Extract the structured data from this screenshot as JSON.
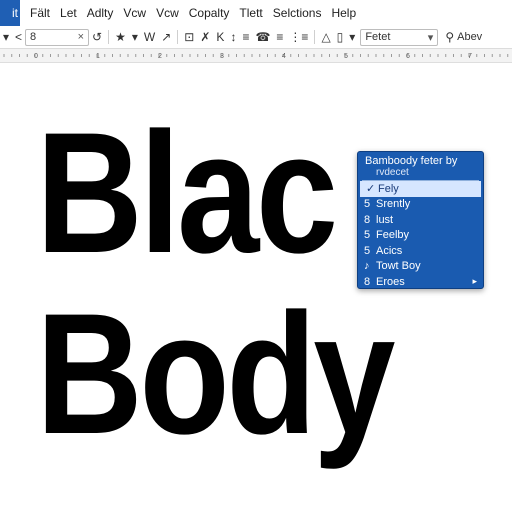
{
  "menubar": {
    "app_menu_label": "it",
    "items": [
      "Fält",
      "Let",
      "Adlty",
      "Vcw",
      "Vcw",
      "Copalty",
      "Tlett",
      "Selctions",
      "Help"
    ]
  },
  "toolbar": {
    "field_value": "8",
    "field_clear": "×",
    "style_field_value": "Fetet",
    "style_field_arrow": "▾",
    "right_label": "Abev",
    "glyphs": {
      "g1": "▾",
      "g2": "<",
      "g3": "↺",
      "g4": "★",
      "g5": "▾",
      "g6": "W",
      "g7": "↗",
      "g8": "⊡",
      "g9": "✗",
      "g10": "K",
      "g11": "↕",
      "g12": "≡",
      "g13": "☎",
      "g14": "≡",
      "g15": "⋮≡",
      "g16": "△",
      "g17": "▯",
      "g18": "▾",
      "g19": "⚲"
    }
  },
  "ruler": {
    "labels": [
      "0",
      "1",
      "2",
      "3",
      "4",
      "5",
      "6",
      "7"
    ]
  },
  "document": {
    "line1": "Blac",
    "line2": "Body"
  },
  "context_menu": {
    "title": "Bamboody feter by",
    "subtitle": "rvdecet",
    "items": [
      {
        "marker": "✓",
        "label": "Fely",
        "selected": true
      },
      {
        "marker": "5",
        "label": "Srently"
      },
      {
        "marker": "8",
        "label": "lust"
      },
      {
        "marker": "5",
        "label": "Feelby"
      },
      {
        "marker": "5",
        "label": "Acics"
      },
      {
        "marker": "♪",
        "label": "Towt Boy"
      },
      {
        "marker": "8",
        "label": "Eroes",
        "arrow": "▸"
      }
    ]
  },
  "colors": {
    "accent": "#1f5fb4",
    "menu_bg": "#1a5bb0",
    "menu_selected": "#d6e6ff",
    "text": "#000000"
  }
}
